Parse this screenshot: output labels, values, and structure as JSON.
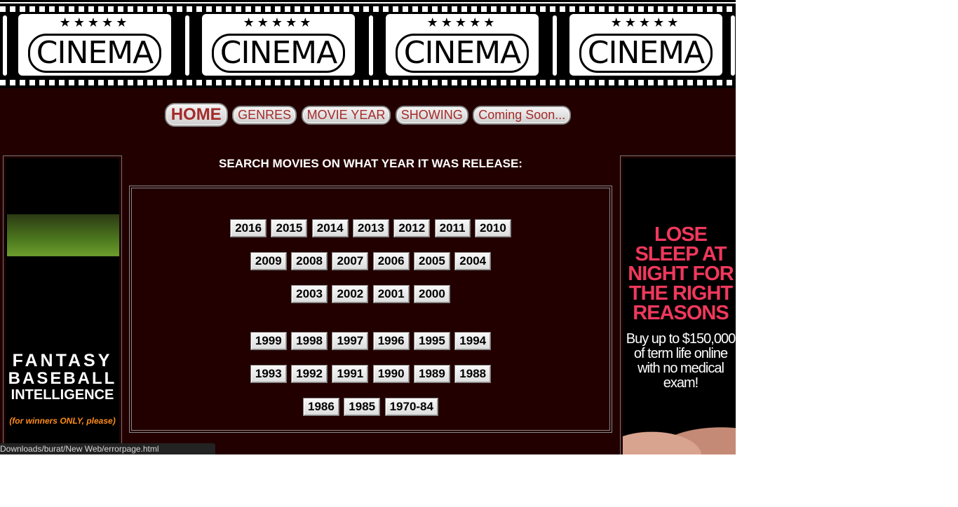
{
  "banner": {
    "frames": [
      {
        "stars": "★★★★★",
        "word": "CINEMA"
      },
      {
        "stars": "★★★★★",
        "word": "CINEMA"
      },
      {
        "stars": "★★★★★",
        "word": "CINEMA"
      },
      {
        "stars": "★★★★★",
        "word": "CINEMA"
      }
    ]
  },
  "nav": {
    "items": [
      {
        "label": "HOME"
      },
      {
        "label": "GENRES"
      },
      {
        "label": "MOVIE YEAR"
      },
      {
        "label": "SHOWING"
      },
      {
        "label": "Coming Soon..."
      }
    ]
  },
  "search": {
    "heading": "SEARCH MOVIES ON WHAT YEAR IT WAS RELEASE:"
  },
  "years": {
    "rows": [
      [
        "2016",
        "2015",
        "2014",
        "2013",
        "2012",
        "2011",
        "2010"
      ],
      [
        "2009",
        "2008",
        "2007",
        "2006",
        "2005",
        "2004"
      ],
      [
        "2003",
        "2002",
        "2001",
        "2000"
      ],
      [
        "1999",
        "1998",
        "1997",
        "1996",
        "1995",
        "1994"
      ],
      [
        "1993",
        "1992",
        "1991",
        "1990",
        "1989",
        "1988"
      ],
      [
        "1986",
        "1985",
        "1970-84"
      ]
    ]
  },
  "ad_left": {
    "line1": "FANTASY",
    "line2": "BASEBALL",
    "line3": "INTELLIGENCE",
    "tagline": "(for winners ONLY, please)"
  },
  "ad_right": {
    "headline": "LOSE SLEEP AT NIGHT FOR THE RIGHT REASONS",
    "sub": "Buy up to $150,000 of term life online with no medical exam!"
  },
  "status_bar": {
    "url": "Downloads/burat/New Web/errorpage.html"
  },
  "colors": {
    "page_bg": "#220000",
    "nav_text": "#a52a2a",
    "ad_headline": "#f0385c",
    "ad_tagline": "#ff8c1a"
  }
}
